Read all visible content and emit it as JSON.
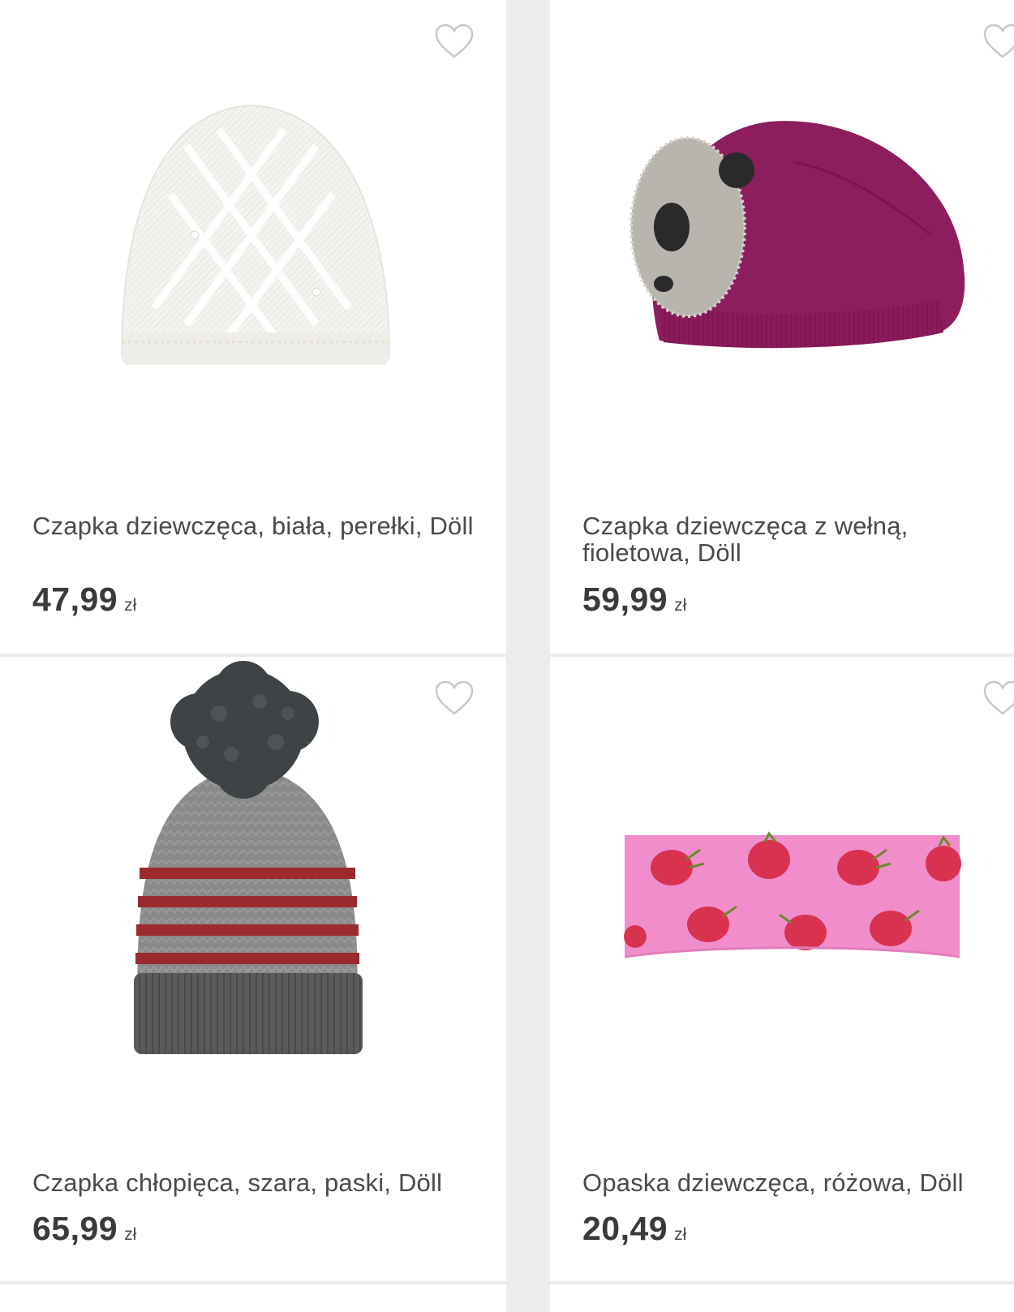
{
  "products": [
    {
      "title": "Czapka dziewczęca, biała, perełki, Döll",
      "price": "47,99",
      "currency": "zł",
      "icon": "heart-outline-icon"
    },
    {
      "title": "Czapka dziewczęca z wełną, fioletowa, Döll",
      "price": "59,99",
      "currency": "zł",
      "icon": "heart-outline-icon"
    },
    {
      "title": "Czapka chłopięca, szara, paski, Döll",
      "price": "65,99",
      "currency": "zł",
      "icon": "heart-outline-icon"
    },
    {
      "title": "Opaska dziewczęca, różowa, Döll",
      "price": "20,49",
      "currency": "zł",
      "icon": "heart-outline-icon"
    }
  ],
  "colors": {
    "background": "#ececec",
    "card": "#ffffff",
    "text": "#4a4a4a",
    "heart_outline": "#c8c8c8"
  }
}
